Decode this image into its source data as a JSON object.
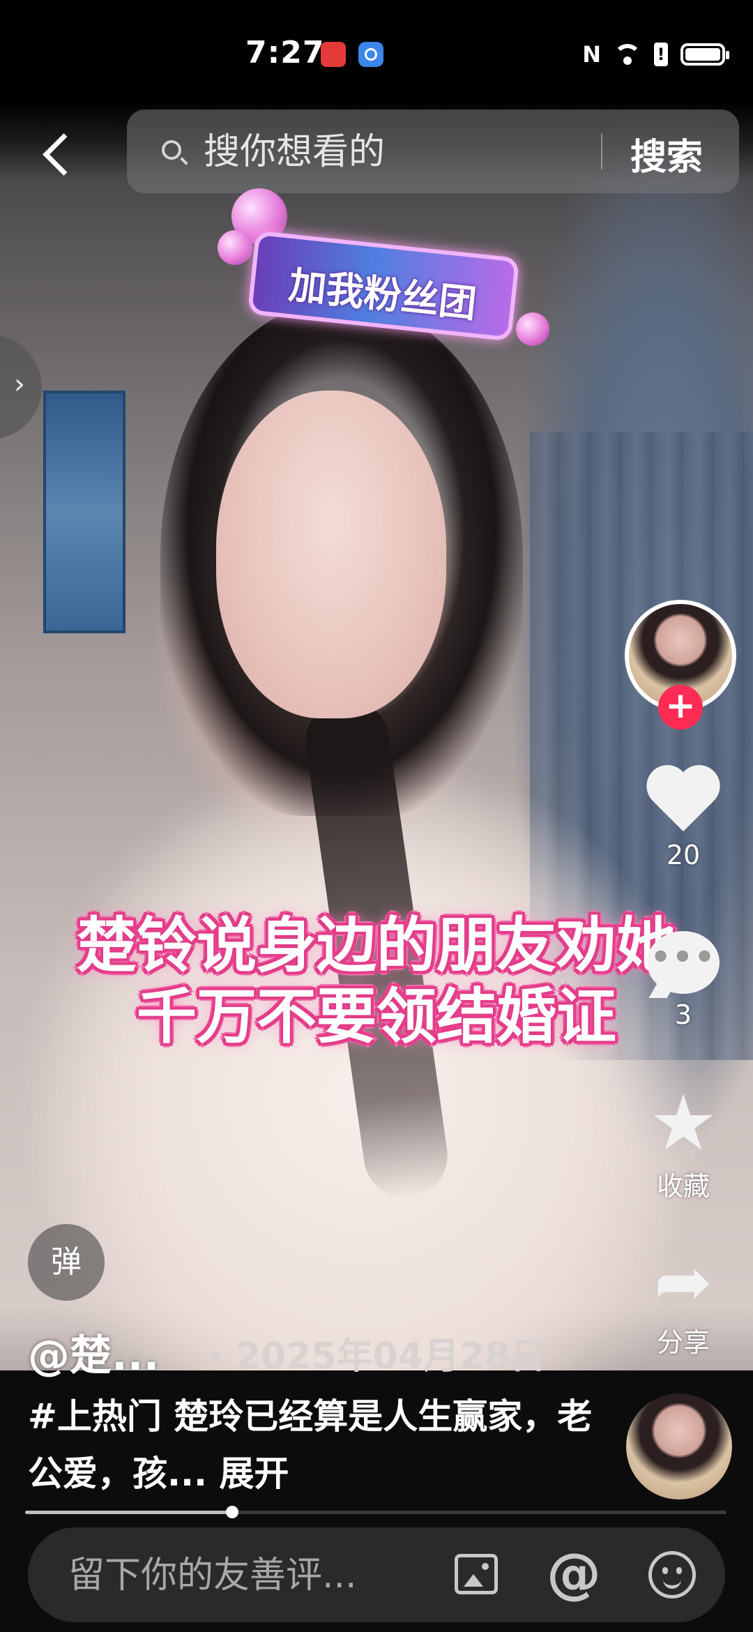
{
  "status_bar": {
    "time": "7:27",
    "nfc": "N",
    "alert": "!"
  },
  "search": {
    "placeholder": "搜你想看的",
    "button_label": "搜索"
  },
  "side_tab": {
    "label": "›"
  },
  "video": {
    "sticker_text": "加我粉丝团",
    "caption_lines": [
      "楚铃说身边的朋友劝她",
      "千万不要领结婚证"
    ]
  },
  "actions": {
    "follow_label": "+",
    "like_count": "20",
    "comment_count": "3",
    "comment_glyph": "•••",
    "favorite_label": "收藏",
    "favorite_glyph": "★",
    "share_label": "分享",
    "share_glyph": "➦"
  },
  "danmaku": {
    "label": "弹"
  },
  "post": {
    "author": "@楚...",
    "date": "· 2025年04月28日",
    "description": "#上热门 楚玲已经算是人生赢家，老公爱，孩...",
    "expand_label": "展开"
  },
  "progress": {
    "played_fraction": 0.295
  },
  "comment_bar": {
    "placeholder": "留下你的友善评...",
    "mention_glyph": "@"
  }
}
